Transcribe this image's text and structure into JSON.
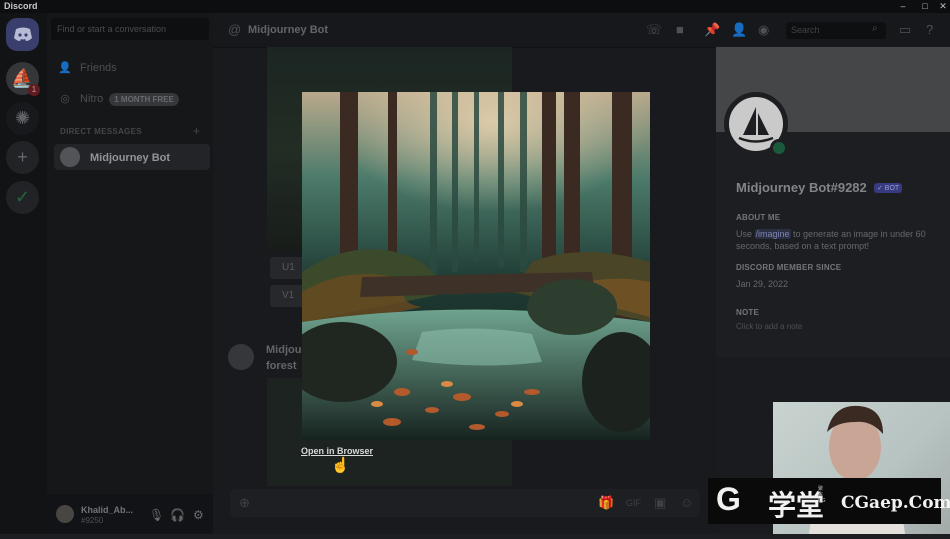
{
  "window": {
    "title": "Discord",
    "minimize": "–",
    "maximize": "□",
    "close": "✕"
  },
  "rail": {
    "home_icon": "discord-logo",
    "badge": "1"
  },
  "sidebar": {
    "search_placeholder": "Find or start a conversation",
    "friends": "Friends",
    "nitro": "Nitro",
    "nitro_badge": "1 MONTH FREE",
    "dm_header": "DIRECT MESSAGES",
    "dm_add": "+",
    "dms": [
      {
        "name": "Midjourney Bot"
      }
    ]
  },
  "user": {
    "name": "Khalid_Ab...",
    "tag": "#9250"
  },
  "header": {
    "channel": "Midjourney Bot",
    "search_placeholder": "Search"
  },
  "chat": {
    "buttons": [
      "U1",
      "V1"
    ],
    "message_author": "Midjou",
    "message_text": "forest"
  },
  "profile": {
    "name": "Midjourney Bot#9282",
    "bot_tag": "✓ BOT",
    "about_title": "ABOUT ME",
    "about_prefix": "Use ",
    "about_command": "/imagine",
    "about_suffix": " to generate an image in under 60 seconds, based on a text prompt!",
    "member_title": "DISCORD MEMBER SINCE",
    "member_date": "Jan 29, 2022",
    "note_title": "NOTE",
    "note_placeholder": "Click to add a note"
  },
  "modal": {
    "open_in_browser": "Open in Browser"
  },
  "watermark": {
    "logo": "G",
    "text": "学堂",
    "side": "聚焦CG",
    "site": "CGaep.Com"
  },
  "colors": {
    "accent": "#5865f2",
    "online": "#23a55a"
  }
}
